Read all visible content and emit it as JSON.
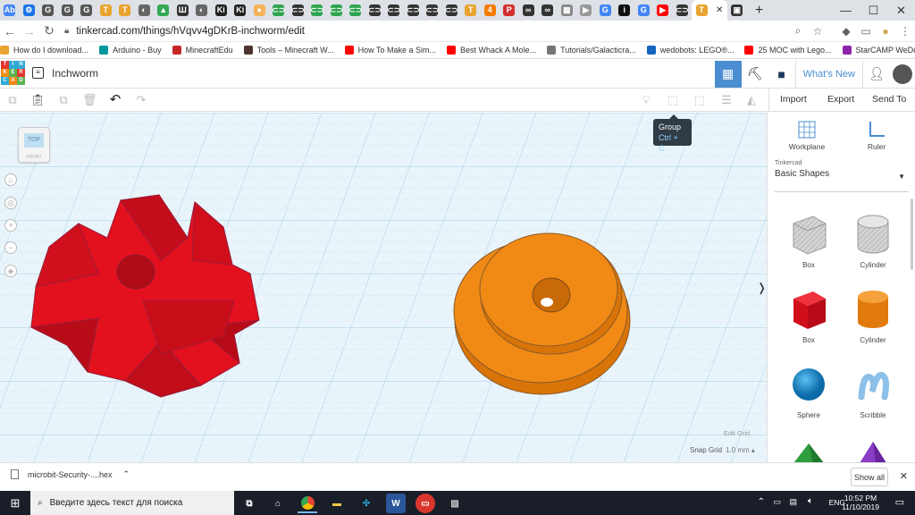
{
  "browser": {
    "tabs": [
      {
        "icon": "docs-icon",
        "color": "#4285f4",
        "glyph": "Ab"
      },
      {
        "icon": "settings-icon",
        "color": "#1a73e8",
        "glyph": "⚙"
      },
      {
        "icon": "google-classroom-icon",
        "color": "#555",
        "glyph": "G"
      },
      {
        "icon": "google-classroom-icon",
        "color": "#555",
        "glyph": "G"
      },
      {
        "icon": "google-classroom-icon",
        "color": "#555",
        "glyph": "G"
      },
      {
        "icon": "tinkercad-icon",
        "color": "#e8a430",
        "glyph": "T"
      },
      {
        "icon": "tinkercad-icon",
        "color": "#e8a430",
        "glyph": "T"
      },
      {
        "icon": "compass-icon",
        "color": "#666",
        "glyph": "◐"
      },
      {
        "icon": "drive-icon",
        "color": "#34a853",
        "glyph": "▲"
      },
      {
        "icon": "book-icon",
        "color": "#333",
        "glyph": "Ш"
      },
      {
        "icon": "compass-icon",
        "color": "#666",
        "glyph": "◐"
      },
      {
        "icon": "kiddle-icon",
        "color": "#222",
        "glyph": "Ki"
      },
      {
        "icon": "kiddle-icon",
        "color": "#222",
        "glyph": "Ki"
      },
      {
        "icon": "kahoot-icon",
        "color": "#f6b35b",
        "glyph": "●"
      },
      {
        "icon": "link-icon",
        "color": "#2da44e",
        "glyph": "⊂⊃"
      },
      {
        "icon": "link-icon",
        "color": "#333",
        "glyph": "⊂⊃"
      },
      {
        "icon": "link-icon",
        "color": "#2da44e",
        "glyph": "⊂⊃"
      },
      {
        "icon": "link-icon",
        "color": "#2da44e",
        "glyph": "⊂⊃"
      },
      {
        "icon": "link-icon",
        "color": "#2da44e",
        "glyph": "⊂⊃"
      },
      {
        "icon": "link-icon",
        "color": "#333",
        "glyph": "⊂⊃"
      },
      {
        "icon": "link-icon",
        "color": "#333",
        "glyph": "⊂⊃"
      },
      {
        "icon": "link-icon",
        "color": "#333",
        "glyph": "⊂⊃"
      },
      {
        "icon": "link-icon",
        "color": "#333",
        "glyph": "⊂⊃"
      },
      {
        "icon": "link-icon",
        "color": "#333",
        "glyph": "⊂⊃"
      },
      {
        "icon": "tinkercad-icon",
        "color": "#e8a430",
        "glyph": "T"
      },
      {
        "icon": "4a-icon",
        "color": "#f57c00",
        "glyph": "4"
      },
      {
        "icon": "pin-icon",
        "color": "#d32f2f",
        "glyph": "P"
      },
      {
        "icon": "link-icon",
        "color": "#333",
        "glyph": "∞"
      },
      {
        "icon": "link-icon",
        "color": "#333",
        "glyph": "∞"
      },
      {
        "icon": "grid-icon",
        "color": "#888",
        "glyph": "▦"
      },
      {
        "icon": "video-icon",
        "color": "#999",
        "glyph": "▶"
      },
      {
        "icon": "google-icon",
        "color": "#4285f4",
        "glyph": "G"
      },
      {
        "icon": "info-icon",
        "color": "#111",
        "glyph": "i"
      },
      {
        "icon": "google-icon",
        "color": "#4285f4",
        "glyph": "G"
      },
      {
        "icon": "youtube-icon",
        "color": "#ff0000",
        "glyph": "▶"
      },
      {
        "icon": "link-icon",
        "color": "#333",
        "glyph": "⊂⊃"
      }
    ],
    "active_tab": {
      "icon": "tinkercad-icon",
      "close": "✕"
    },
    "new_tab": "+",
    "window_controls": {
      "minimize": "—",
      "maximize": "☐",
      "close": "✕"
    },
    "url": "tinkercad.com/things/hVqvv4gDKrB-inchworm/edit",
    "bookmarks": [
      {
        "label": "How do I download...",
        "color": "#e8a430"
      },
      {
        "label": "Arduino - Buy",
        "color": "#00979d"
      },
      {
        "label": "MinecraftEdu",
        "color": "#c62828"
      },
      {
        "label": "Tools – Minecraft W...",
        "color": "#4e342e"
      },
      {
        "label": "How To Make a Sim...",
        "color": "#ff0000"
      },
      {
        "label": "Best Whack A Mole...",
        "color": "#ff0000"
      },
      {
        "label": "Tutorials/Galacticra...",
        "color": "#757575"
      },
      {
        "label": "wedobots: LEGO®...",
        "color": "#1565c0"
      },
      {
        "label": "25 MOC with Lego...",
        "color": "#ff0000"
      },
      {
        "label": "StarCAMP WeDo | L...",
        "color": "#8e24aa"
      }
    ]
  },
  "app": {
    "logo_letters": [
      "TIN",
      "KER",
      "CAD"
    ],
    "logo_cells": [
      "T",
      "I",
      "N",
      "K",
      "E",
      "R",
      "C",
      "A",
      "D"
    ],
    "design_title": "Inchworm",
    "whats_new": "What's New",
    "toolbar": {
      "import": "Import",
      "export": "Export",
      "send_to": "Send To"
    },
    "tooltip": {
      "title": "Group",
      "shortcut": "Ctrl + G"
    },
    "viewcube_label": "TOP",
    "viewcube_sub": "FRONT",
    "snap_grid_label": "Snap Grid",
    "snap_grid_value": "1.0 mm",
    "edit_grid": "Edit Grid",
    "collapse_arrow": "❭"
  },
  "panel": {
    "workplane": "Workplane",
    "ruler": "Ruler",
    "category_caption": "Tinkercad",
    "category": "Basic Shapes",
    "shapes": [
      {
        "label": "Box",
        "style": "hole"
      },
      {
        "label": "Cylinder",
        "style": "hole"
      },
      {
        "label": "Box",
        "style": "solid",
        "color": "#e3101e"
      },
      {
        "label": "Cylinder",
        "style": "solid",
        "color": "#f08a14"
      },
      {
        "label": "Sphere",
        "style": "solid",
        "color": "#1a8bd0"
      },
      {
        "label": "Scribble",
        "style": "solid",
        "color": "#7ab4e0"
      }
    ]
  },
  "download": {
    "file": "microbit-Security-....hex",
    "show_all": "Show all"
  },
  "taskbar": {
    "search_placeholder": "Введите здесь текст для поиска",
    "lang": "ENG",
    "time": "10:52 PM",
    "date": "11/10/2019"
  },
  "colors": {
    "accent": "#4b8dd1",
    "red_part": "#e3101e",
    "orange_part": "#f08a14",
    "grid_line": "#b5d9ea"
  }
}
